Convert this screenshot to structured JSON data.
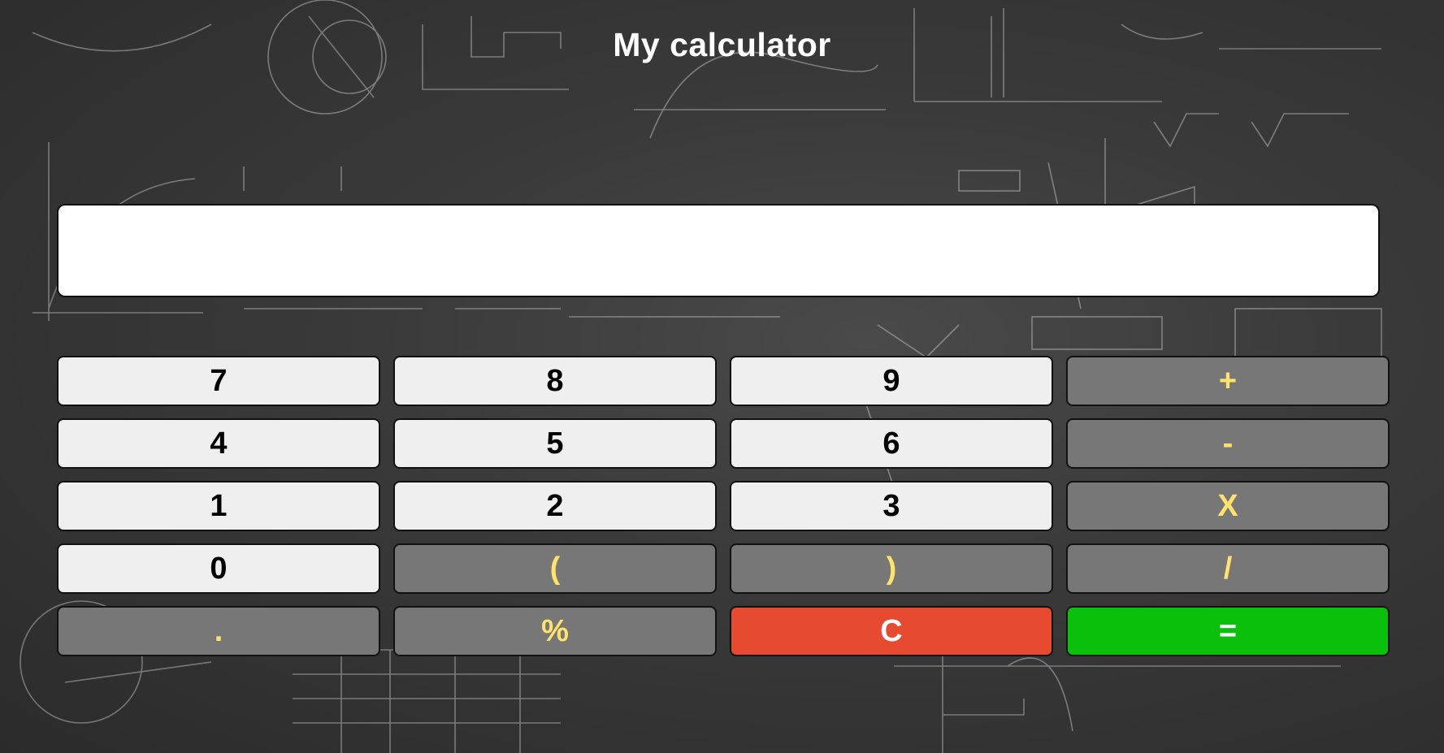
{
  "app": {
    "title": "My calculator"
  },
  "display": {
    "value": ""
  },
  "keys": [
    {
      "label": "7",
      "kind": "num",
      "name": "key-7"
    },
    {
      "label": "8",
      "kind": "num",
      "name": "key-8"
    },
    {
      "label": "9",
      "kind": "num",
      "name": "key-9"
    },
    {
      "label": "+",
      "kind": "op",
      "name": "key-plus"
    },
    {
      "label": "4",
      "kind": "num",
      "name": "key-4"
    },
    {
      "label": "5",
      "kind": "num",
      "name": "key-5"
    },
    {
      "label": "6",
      "kind": "num",
      "name": "key-6"
    },
    {
      "label": "-",
      "kind": "op",
      "name": "key-minus"
    },
    {
      "label": "1",
      "kind": "num",
      "name": "key-1"
    },
    {
      "label": "2",
      "kind": "num",
      "name": "key-2"
    },
    {
      "label": "3",
      "kind": "num",
      "name": "key-3"
    },
    {
      "label": "X",
      "kind": "op",
      "name": "key-multiply"
    },
    {
      "label": "0",
      "kind": "num",
      "name": "key-0"
    },
    {
      "label": "(",
      "kind": "op",
      "name": "key-open-paren"
    },
    {
      "label": ")",
      "kind": "op",
      "name": "key-close-paren"
    },
    {
      "label": "/",
      "kind": "op",
      "name": "key-divide"
    },
    {
      "label": ".",
      "kind": "op",
      "name": "key-decimal"
    },
    {
      "label": "%",
      "kind": "op",
      "name": "key-percent"
    },
    {
      "label": "C",
      "kind": "clear",
      "name": "key-clear"
    },
    {
      "label": "=",
      "kind": "equals",
      "name": "key-equals"
    }
  ],
  "colors": {
    "number_key_bg": "#efefef",
    "operator_key_bg": "#777777",
    "operator_key_text": "#ffe36b",
    "clear_key_bg": "#e64b32",
    "equals_key_bg": "#0ac00a"
  }
}
